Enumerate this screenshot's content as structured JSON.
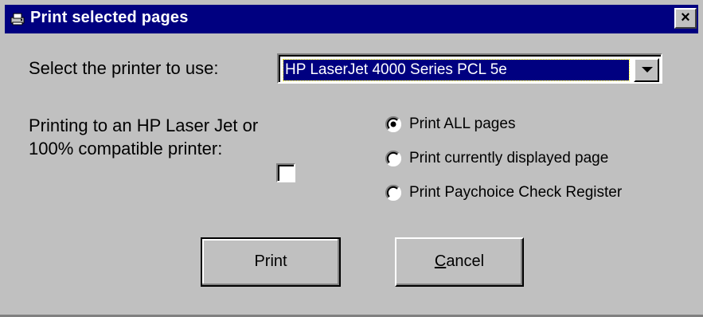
{
  "window": {
    "title": "Print selected pages",
    "close_label": "×"
  },
  "printer": {
    "label": "Select the printer to use:",
    "selected": "HP LaserJet 4000 Series PCL 5e"
  },
  "hp_option": {
    "label": "Printing to an HP Laser Jet or 100% compatible printer:",
    "checked": false
  },
  "pages_options": [
    {
      "label": "Print ALL pages",
      "selected": true
    },
    {
      "label": "Print currently displayed page",
      "selected": false
    },
    {
      "label": "Print Paychoice Check Register",
      "selected": false
    }
  ],
  "buttons": {
    "print_label": "Print",
    "cancel_label": "Cancel",
    "cancel_accesskey": "C"
  },
  "icons": {
    "app": "printer-icon",
    "close": "close-icon",
    "dropdown": "chevron-down-icon"
  },
  "colors": {
    "titlebar": "#000080",
    "face": "#c0c0c0",
    "selection": "#000080"
  }
}
